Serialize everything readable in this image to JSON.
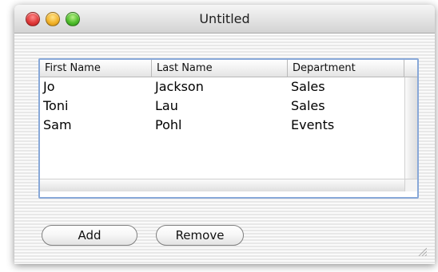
{
  "window": {
    "title": "Untitled"
  },
  "table": {
    "columns": [
      "First Name",
      "Last Name",
      "Department"
    ],
    "rows": [
      [
        "Jo",
        "Jackson",
        "Sales"
      ],
      [
        "Toni",
        "Lau",
        "Sales"
      ],
      [
        "Sam",
        "Pohl",
        "Events"
      ]
    ]
  },
  "buttons": {
    "add": "Add",
    "remove": "Remove"
  },
  "icons": {
    "close": "close-button-icon",
    "minimize": "minimize-button-icon",
    "zoom": "zoom-button-icon",
    "resize": "resize-grip-icon"
  },
  "colors": {
    "table_focus_border": "#88a8d8",
    "close": "#e03a3a",
    "minimize": "#f2b32a",
    "zoom": "#4fbe2b"
  }
}
